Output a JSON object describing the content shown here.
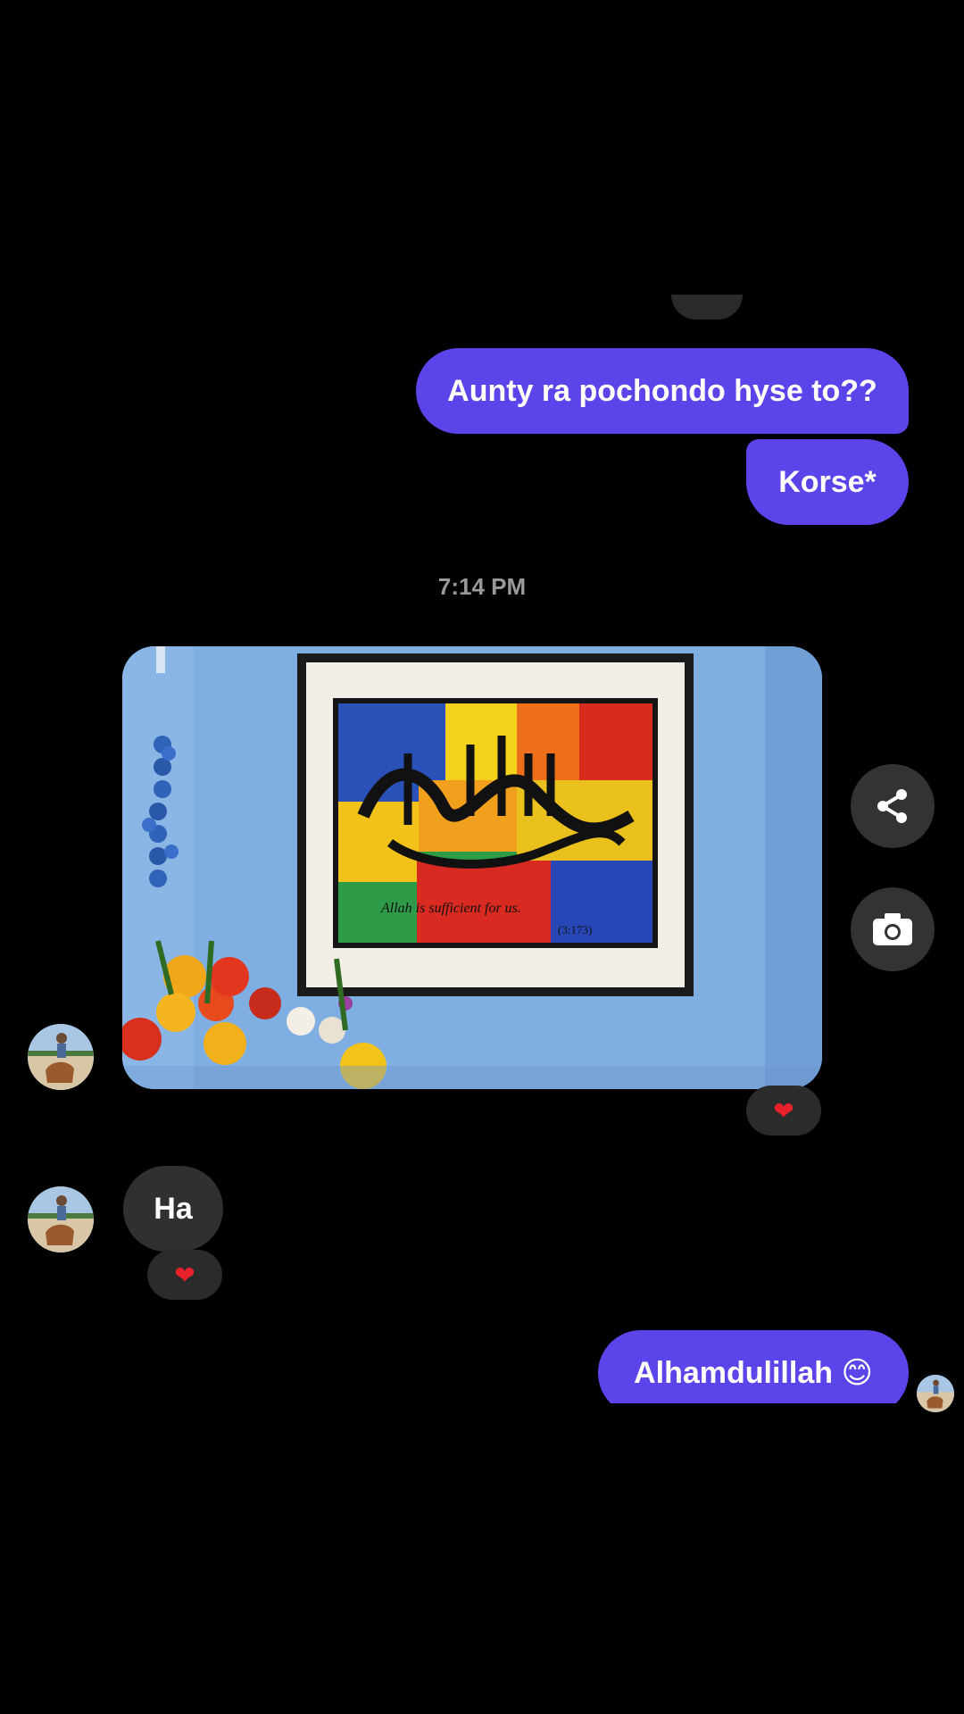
{
  "conversation": {
    "messages_out": [
      {
        "text": "Aunty ra pochondo hyse to??"
      },
      {
        "text": "Korse*"
      }
    ],
    "timestamp": "7:14 PM",
    "incoming_reply": "Ha",
    "last_out": "Alhamdulillah 😊"
  },
  "photo": {
    "caption_text": "Allah is sufficient for us.",
    "reference": "(3:173)"
  },
  "actions": {
    "share_icon": "share-icon",
    "camera_icon": "camera-icon"
  },
  "reactions": {
    "photo": "❤",
    "ha": "❤"
  },
  "colors": {
    "background": "#000000",
    "outgoing_bubble": "#5b45ea",
    "incoming_bubble": "#303030",
    "reaction_heart": "#e8202a"
  }
}
